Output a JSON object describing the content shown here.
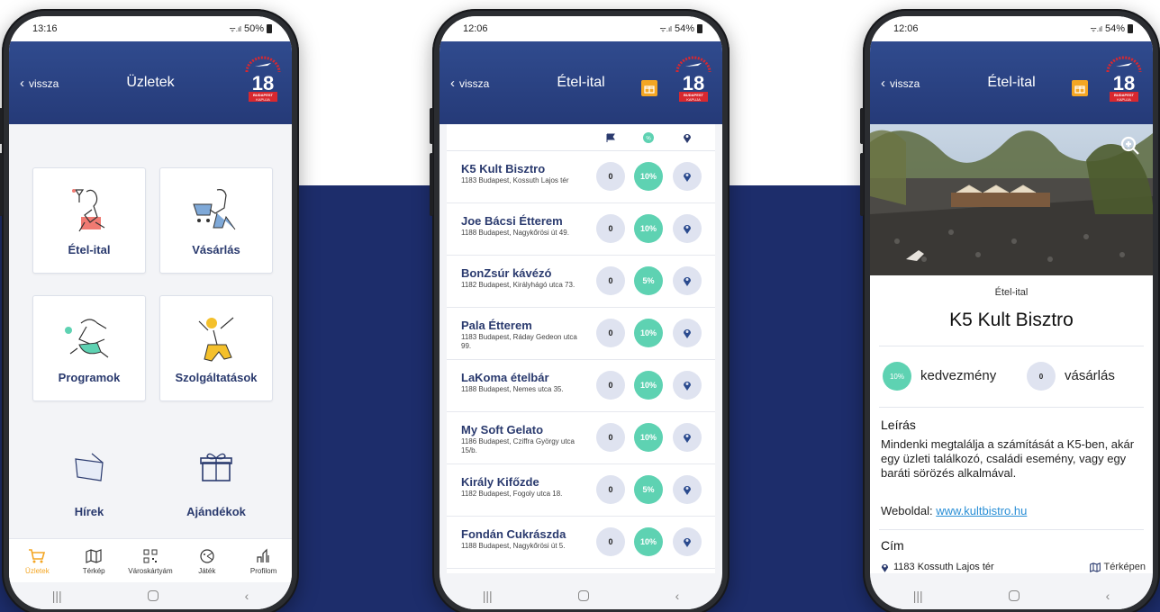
{
  "phone1": {
    "status": {
      "time": "13:16",
      "battery": "50%"
    },
    "header": {
      "back_label": "vissza",
      "title": "Üzletek"
    },
    "categories": [
      {
        "label": "Étel-ital"
      },
      {
        "label": "Vásárlás"
      },
      {
        "label": "Programok"
      },
      {
        "label": "Szolgáltatások"
      },
      {
        "label": "Hírek"
      },
      {
        "label": "Ajándékok"
      }
    ],
    "tabs": [
      {
        "label": "Üzletek",
        "icon": "cart-icon"
      },
      {
        "label": "Térkép",
        "icon": "map-icon"
      },
      {
        "label": "Városkártyám",
        "icon": "qr-icon"
      },
      {
        "label": "Játék",
        "icon": "game-icon"
      },
      {
        "label": "Profilom",
        "icon": "profile-icon"
      }
    ]
  },
  "phone2": {
    "status": {
      "time": "12:06",
      "battery": "54%"
    },
    "header": {
      "back_label": "vissza",
      "title": "Étel-ital"
    },
    "rows": [
      {
        "name": "K5 Kult Bisztro",
        "address": "1183 Budapest, Kossuth Lajos tér",
        "count": "0",
        "discount": "10%"
      },
      {
        "name": "Joe Bácsi Étterem",
        "address": "1188 Budapest, Nagykőrösi út 49.",
        "count": "0",
        "discount": "10%"
      },
      {
        "name": "BonZsúr kávézó",
        "address": "1182 Budapest, Királyhágó utca 73.",
        "count": "0",
        "discount": "5%"
      },
      {
        "name": "Pala Étterem",
        "address": "1183 Budapest, Ráday Gedeon utca 99.",
        "count": "0",
        "discount": "10%"
      },
      {
        "name": "LaKoma ételbár",
        "address": "1188 Budapest, Nemes utca 35.",
        "count": "0",
        "discount": "10%"
      },
      {
        "name": "My Soft Gelato",
        "address": "1186 Budapest, Cziffra György utca 15/b.",
        "count": "0",
        "discount": "10%"
      },
      {
        "name": "Király Kifőzde",
        "address": "1182 Budapest, Fogoly utca 18.",
        "count": "0",
        "discount": "5%"
      },
      {
        "name": "Fondán Cukrászda",
        "address": "1188 Budapest, Nagykőrösi út 5.",
        "count": "0",
        "discount": "10%"
      }
    ]
  },
  "phone3": {
    "status": {
      "time": "12:06",
      "battery": "54%"
    },
    "header": {
      "back_label": "vissza",
      "title": "Étel-ital"
    },
    "category": "Étel-ital",
    "place_name": "K5 Kult Bisztro",
    "discount": "10%",
    "discount_label": "kedvezmény",
    "purchases": "0",
    "purchases_label": "vásárlás",
    "description_heading": "Leírás",
    "description": "Mindenki megtalálja a számítását a K5-ben, akár egy üzleti találkozó, családi esemény, vagy egy baráti sörözés alkalmával.",
    "website_label": "Weboldal:",
    "website": "www.kultbistro.hu",
    "address_heading": "Cím",
    "address": "1183 Kossuth Lajos tér",
    "map_link": "Térképen"
  },
  "logo": {
    "number": "18",
    "line1": "BUDAPEST",
    "line2": "KAPUJA"
  },
  "colors": {
    "header": "#2a4282",
    "navy": "#1d2d6b",
    "accent": "#f4a623",
    "teal": "#5ed2b2",
    "title": "#2a3a6e"
  }
}
